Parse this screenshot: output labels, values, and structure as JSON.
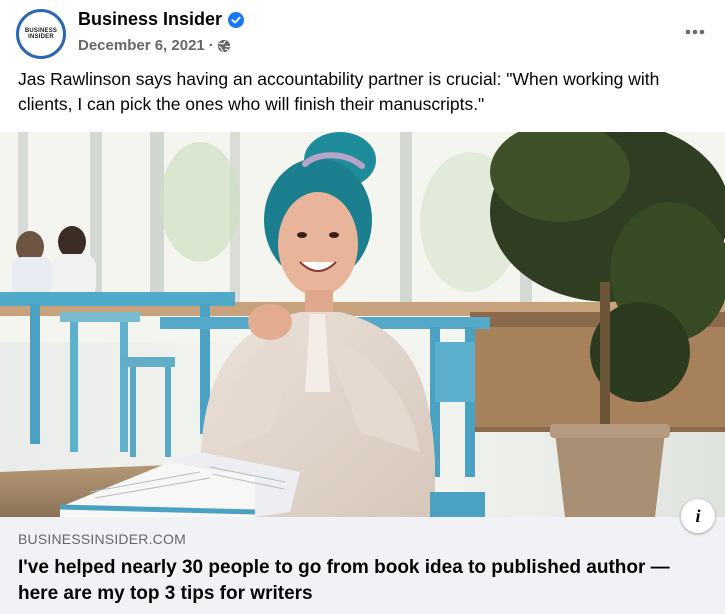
{
  "post": {
    "page_name": "Business Insider",
    "avatar_text_line1": "BUSINESS",
    "avatar_text_line2": "INSIDER",
    "date": "December 6, 2021",
    "separator": "·",
    "caption": "Jas Rawlinson says having an accountability partner is crucial: \"When working with clients, I can pick the ones who will finish their manuscripts.\""
  },
  "link_preview": {
    "domain": "BUSINESSINSIDER.COM",
    "headline": "I've helped nearly 30 people to go from book idea to published author — here are my top 3 tips for writers",
    "info_icon": "i"
  },
  "icons": {
    "verified": "verified-badge-icon",
    "globe": "globe-icon",
    "more": "more-options-icon",
    "info": "info-icon"
  },
  "colors": {
    "brand_blue": "#1877f2",
    "text_primary": "#050505",
    "text_secondary": "#65676b",
    "link_bg": "#f0f2f5",
    "avatar_ring": "#2b66b2"
  }
}
